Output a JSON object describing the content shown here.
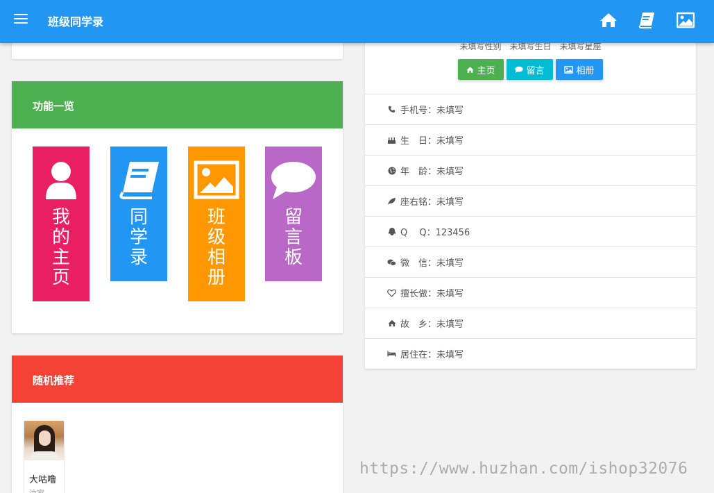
{
  "app": {
    "title": "班级同学录"
  },
  "header_icons": [
    "home-icon",
    "book-icon",
    "image-icon"
  ],
  "features": {
    "title": "功能一览",
    "color": "#4caf50",
    "tiles": [
      {
        "label": "我的主页",
        "color": "#e91e63",
        "icon": "user-icon"
      },
      {
        "label": "同学录",
        "color": "#2196f3",
        "icon": "book-icon"
      },
      {
        "label": "班级相册",
        "color": "#ff9800",
        "icon": "image-icon"
      },
      {
        "label": "留言板",
        "color": "#ba68c8",
        "icon": "comment-icon"
      }
    ]
  },
  "random": {
    "title": "随机推荐",
    "color": "#f44336",
    "person": {
      "name": "大咕噜",
      "sub": "汶家"
    }
  },
  "profile": {
    "summary": "未填写性别　未填写生日　未填写星座",
    "buttons": [
      {
        "label": "主页",
        "color": "#4caf50",
        "icon": "home-icon"
      },
      {
        "label": "留言",
        "color": "#00bcd4",
        "icon": "comment-icon"
      },
      {
        "label": "相册",
        "color": "#2196f3",
        "icon": "image-icon"
      }
    ],
    "rows": [
      {
        "label": "手机号：未填写",
        "icon": "phone-icon"
      },
      {
        "label": "生　日：未填写",
        "icon": "cake-icon"
      },
      {
        "label": "年　龄：未填写",
        "icon": "globe-icon"
      },
      {
        "label": "座右铭：未填写",
        "icon": "leaf-icon"
      },
      {
        "label": "Q　 Q：123456",
        "icon": "qq-icon"
      },
      {
        "label": "微　信：未填写",
        "icon": "wechat-icon"
      },
      {
        "label": "擅长做：未填写",
        "icon": "heart-icon"
      },
      {
        "label": "故　乡：未填写",
        "icon": "home-icon"
      },
      {
        "label": "居住在：未填写",
        "icon": "bed-icon"
      }
    ]
  },
  "watermark": "https://www.huzhan.com/ishop32076"
}
